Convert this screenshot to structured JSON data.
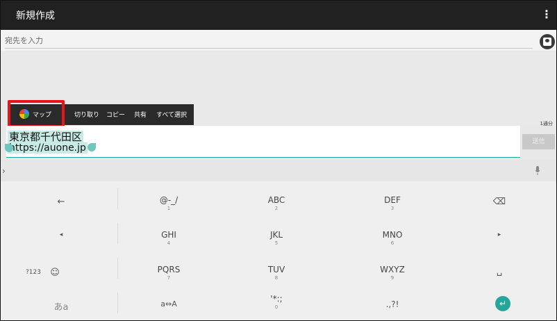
{
  "appbar": {
    "title": "新規作成",
    "menu_icon": "⋮"
  },
  "recipient": {
    "placeholder": "宛先を入力"
  },
  "selection_toolbar": {
    "items": [
      "マップ",
      "切り取り",
      "コピー",
      "共有",
      "すべて選択"
    ],
    "highlight_color": "#e8141a"
  },
  "counter": "1通分",
  "compose": {
    "line1": "東京都千代田区",
    "line2": "https://auone.jp",
    "send_label": "送信"
  },
  "keyboard": {
    "row1": [
      {
        "main": "←",
        "sub": ""
      },
      {
        "main": "@-_/",
        "sub": "1"
      },
      {
        "main": "ABC",
        "sub": "2"
      },
      {
        "main": "DEF",
        "sub": "3"
      },
      {
        "main": "⌫",
        "sub": ""
      }
    ],
    "row2": [
      {
        "main": "◂",
        "sub": ""
      },
      {
        "main": "GHI",
        "sub": "4"
      },
      {
        "main": "JKL",
        "sub": "5"
      },
      {
        "main": "MNO",
        "sub": "6"
      },
      {
        "main": "▸",
        "sub": ""
      }
    ],
    "row3": [
      {
        "main": "?123",
        "sub": ""
      },
      {
        "main": "☺",
        "sub": ""
      },
      {
        "main": "PQRS",
        "sub": "7"
      },
      {
        "main": "TUV",
        "sub": "8"
      },
      {
        "main": "WXYZ",
        "sub": "9"
      },
      {
        "main": "␣",
        "sub": ""
      }
    ],
    "row4": [
      {
        "main": "あa",
        "sub": ""
      },
      {
        "main": "a⇔A",
        "sub": ""
      },
      {
        "main": "'*:;",
        "sub": "0"
      },
      {
        "main": ".,?!",
        "sub": ""
      },
      {
        "main": "↵",
        "sub": ""
      }
    ]
  },
  "colors": {
    "accent": "#26a69a",
    "appbar": "#212121"
  }
}
